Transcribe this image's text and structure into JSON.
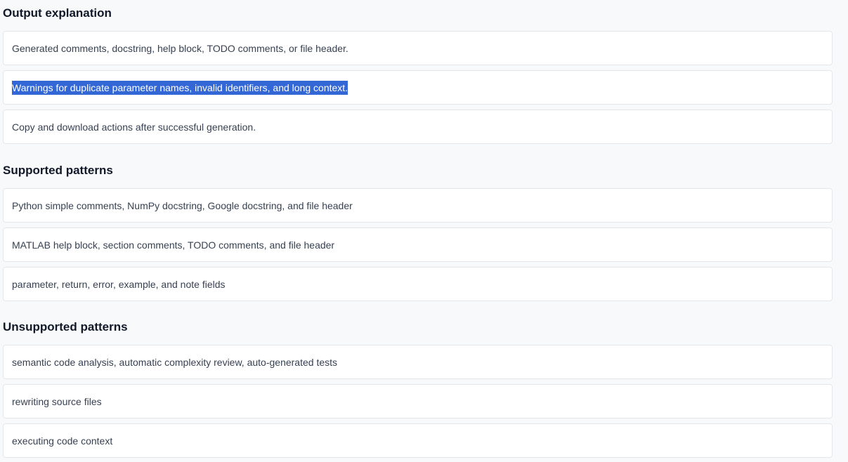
{
  "sections": [
    {
      "title": "Output explanation",
      "items": [
        "Generated comments, docstring, help block, TODO comments, or file header.",
        "Warnings for duplicate parameter names, invalid identifiers, and long context.",
        "Copy and download actions after successful generation."
      ]
    },
    {
      "title": "Supported patterns",
      "items": [
        "Python simple comments, NumPy docstring, Google docstring, and file header",
        "MATLAB help block, section comments, TODO comments, and file header",
        "parameter, return, error, example, and note fields"
      ]
    },
    {
      "title": "Unsupported patterns",
      "items": [
        "semantic code analysis, automatic complexity review, auto-generated tests",
        "rewriting source files",
        "executing code context"
      ]
    }
  ],
  "selection": {
    "section_index": 0,
    "item_index": 1,
    "highlight_color": "#3367d6"
  }
}
